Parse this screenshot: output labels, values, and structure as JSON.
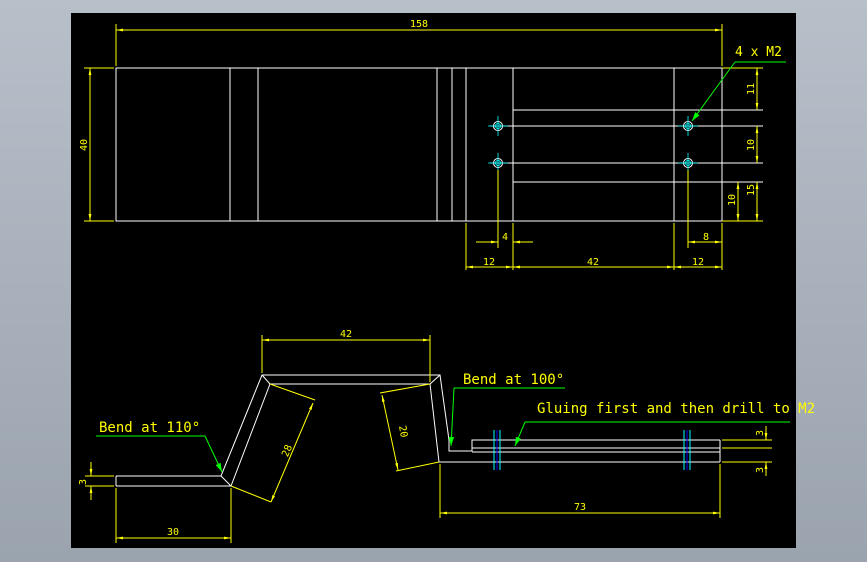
{
  "colors": {
    "background": "#000000",
    "outline": "#ffffff",
    "dimension": "#ffff00",
    "leader": "#00ff00",
    "hole": "#00ffff",
    "hole_mark": "#0000ff"
  },
  "top_view": {
    "overall_length": "158",
    "height": "40",
    "callout": "4 x M2",
    "dim_11": "11",
    "dim_10a": "10",
    "dim_15": "15",
    "dim_10b": "10",
    "dim_4": "4",
    "dim_8": "8",
    "dim_12a": "12",
    "dim_42": "42",
    "dim_12b": "12"
  },
  "side_view": {
    "dim_42": "42",
    "dim_28": "28",
    "dim_20": "20",
    "dim_3a": "3",
    "dim_30": "30",
    "dim_73": "73",
    "dim_3b": "3",
    "dim_3c": "3",
    "note_bend110": "Bend at 110°",
    "note_bend100": "Bend at 100°",
    "note_glue": "Gluing first and then drill to M2"
  }
}
